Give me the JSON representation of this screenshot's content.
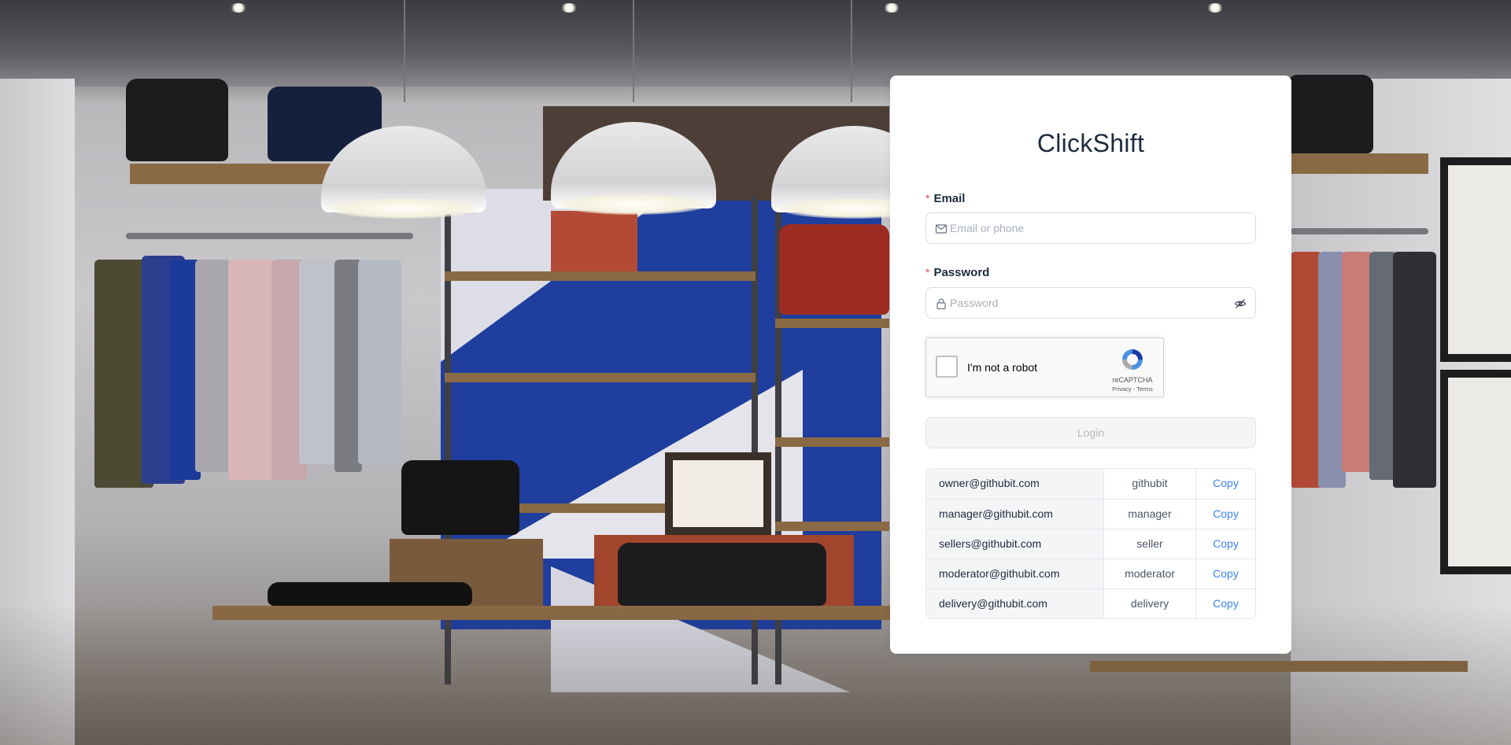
{
  "app": {
    "title": "ClickShift"
  },
  "form": {
    "email": {
      "label": "Email",
      "required_marker": "*",
      "placeholder": "Email or phone",
      "value": "",
      "icon": "mail-icon"
    },
    "password": {
      "label": "Password",
      "required_marker": "*",
      "placeholder": "Password",
      "value": "",
      "icon": "lock-icon",
      "toggle_icon": "eye-off-icon"
    },
    "captcha": {
      "label": "I'm not a robot",
      "brand": "reCAPTCHA",
      "links": "Privacy - Terms",
      "checked": false
    },
    "login_button": "Login"
  },
  "demo_accounts": [
    {
      "email": "owner@githubit.com",
      "role": "githubit",
      "action": "Copy"
    },
    {
      "email": "manager@githubit.com",
      "role": "manager",
      "action": "Copy"
    },
    {
      "email": "sellers@githubit.com",
      "role": "seller",
      "action": "Copy"
    },
    {
      "email": "moderator@githubit.com",
      "role": "moderator",
      "action": "Copy"
    },
    {
      "email": "delivery@githubit.com",
      "role": "delivery",
      "action": "Copy"
    }
  ],
  "colors": {
    "title": "#1f2b3d",
    "required": "#e5484d",
    "link": "#3b82f6",
    "disabled_button_bg": "#f5f5f5",
    "disabled_button_text": "#b8b8b8"
  }
}
